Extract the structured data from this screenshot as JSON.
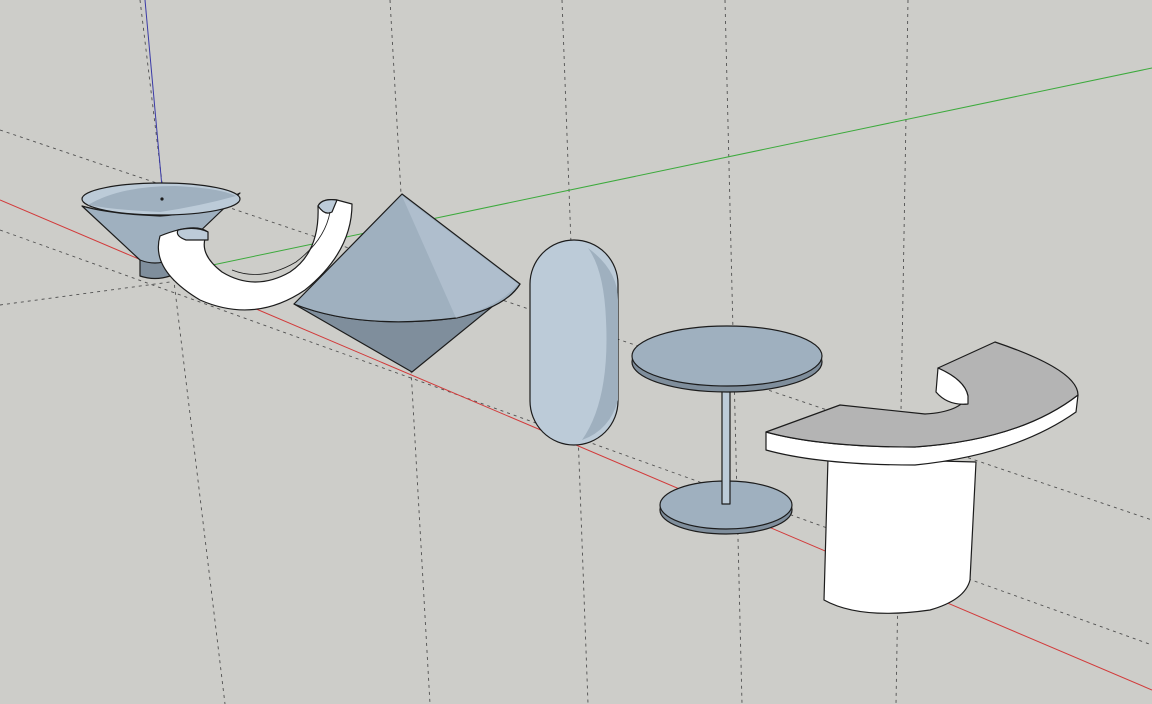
{
  "app": {
    "view": "3d-modeling-viewport",
    "projection": "perspective"
  },
  "colors": {
    "background": "#cdcdc9",
    "axis_red": "#d23a3a",
    "axis_green": "#3caa3c",
    "axis_blue": "#3a3aa8",
    "grid": "#505050",
    "face_blue": "#9fb0bf",
    "face_blue_light": "#bccbd8",
    "face_blue_dark": "#7f8e9c",
    "face_white": "#ffffff",
    "face_grey": "#b4b4b4",
    "edge": "#1c1c1c"
  },
  "scene": {
    "objects": [
      {
        "id": "funnel",
        "shape": "truncated-cone-bowl"
      },
      {
        "id": "half-torus",
        "shape": "half-pipe-arc"
      },
      {
        "id": "bicone",
        "shape": "double-cone"
      },
      {
        "id": "capsule",
        "shape": "capsule"
      },
      {
        "id": "pedestal-table",
        "shape": "round-table"
      },
      {
        "id": "arc-desk",
        "shape": "curved-countertop-on-cylinder"
      }
    ]
  }
}
